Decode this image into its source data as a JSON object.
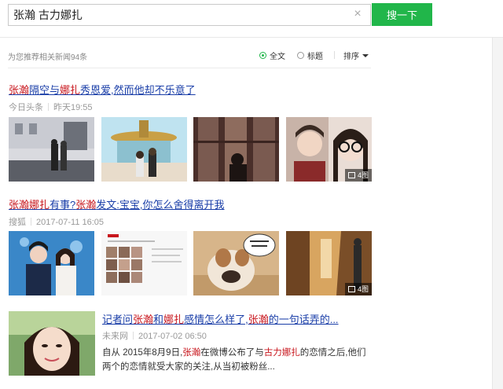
{
  "search": {
    "query": "张瀚 古力娜扎",
    "button_label": "搜一下"
  },
  "filter": {
    "hint": "为您推荐相关新闻94条",
    "option_fulltext": "全文",
    "option_title": "标题",
    "sort_label": "排序"
  },
  "colors": {
    "accent": "#21b64a",
    "link": "#1a3ea8",
    "highlight": "#c8161d"
  },
  "results": [
    {
      "title_parts": [
        {
          "t": "张瀚",
          "hl": true
        },
        {
          "t": "隔空与",
          "hl": false
        },
        {
          "t": "娜扎",
          "hl": true
        },
        {
          "t": "秀恩爱,然而他却不乐意了",
          "hl": false
        }
      ],
      "source": "今日头条",
      "time": "昨天19:55",
      "image_count": "4图"
    },
    {
      "title_parts": [
        {
          "t": "张瀚",
          "hl": true
        },
        {
          "t": "娜扎",
          "hl": true
        },
        {
          "t": "有事?",
          "hl": false
        },
        {
          "t": "张瀚",
          "hl": true
        },
        {
          "t": "发文:宝宝,你怎么舍得离开我",
          "hl": false
        }
      ],
      "source": "搜狐",
      "time": "2017-07-11 16:05",
      "image_count": "4图"
    },
    {
      "title_parts": [
        {
          "t": "记者问",
          "hl": false
        },
        {
          "t": "张瀚",
          "hl": true
        },
        {
          "t": "和",
          "hl": false
        },
        {
          "t": "娜扎",
          "hl": true
        },
        {
          "t": "感情怎么样了,",
          "hl": false
        },
        {
          "t": "张瀚",
          "hl": true
        },
        {
          "t": "的一句话弄的...",
          "hl": false
        }
      ],
      "source": "未来网",
      "time": "2017-07-02 06:50",
      "summary_parts": [
        {
          "t": "自从 2015年8月9日,",
          "hl": false
        },
        {
          "t": "张瀚",
          "hl": true
        },
        {
          "t": "在微博公布了与",
          "hl": false
        },
        {
          "t": "古力娜扎",
          "hl": true
        },
        {
          "t": "的恋情之后,他们两个的恋情就受大家的关注,从当初被粉丝...",
          "hl": false
        }
      ]
    }
  ]
}
